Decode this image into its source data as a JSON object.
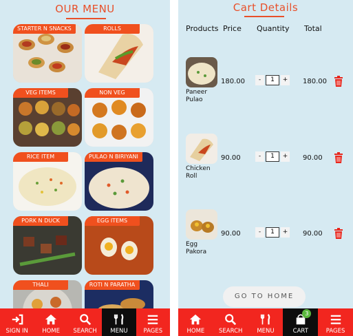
{
  "menu_screen": {
    "title": "OUR MENU",
    "tiles": [
      {
        "label": "STARTER N SNACKS"
      },
      {
        "label": "ROLLS"
      },
      {
        "label": "VEG ITEMS"
      },
      {
        "label": "NON VEG"
      },
      {
        "label": "RICE ITEM"
      },
      {
        "label": "PULAO N BIRIYANI"
      },
      {
        "label": "PORK N DUCK"
      },
      {
        "label": "EGG ITEMS"
      },
      {
        "label": "THALI"
      },
      {
        "label": "ROTI N PARATHA"
      }
    ],
    "nav": [
      {
        "label": "SIGN IN",
        "icon": "sign-in-icon"
      },
      {
        "label": "HOME",
        "icon": "home-icon"
      },
      {
        "label": "SEARCH",
        "icon": "search-icon"
      },
      {
        "label": "MENU",
        "icon": "menu-icon",
        "active": true
      },
      {
        "label": "PAGES",
        "icon": "pages-icon"
      }
    ]
  },
  "cart_screen": {
    "title": "Cart Details",
    "headers": {
      "products": "Products",
      "price": "Price",
      "quantity": "Quantity",
      "total": "Total"
    },
    "items": [
      {
        "name": "Paneer Pulao",
        "price": "180.00",
        "quantity": "1",
        "total": "180.00"
      },
      {
        "name": "Chicken Roll",
        "price": "90.00",
        "quantity": "1",
        "total": "90.00"
      },
      {
        "name": "Egg Pakora",
        "price": "90.00",
        "quantity": "1",
        "total": "90.00"
      }
    ],
    "qty_minus": "-",
    "qty_plus": "+",
    "go_home": "GO TO HOME",
    "nav": [
      {
        "label": "HOME",
        "icon": "home-icon"
      },
      {
        "label": "SEARCH",
        "icon": "search-icon"
      },
      {
        "label": "MENU",
        "icon": "menu-icon"
      },
      {
        "label": "CART",
        "icon": "cart-icon",
        "active": true,
        "badge": "3"
      },
      {
        "label": "PAGES",
        "icon": "pages-icon"
      }
    ]
  },
  "colors": {
    "accent": "#f0501e",
    "nav_bg": "#f2261f",
    "nav_active": "#0d0d0d",
    "screen_bg": "#d6eaf2",
    "badge": "#5bb83e"
  }
}
